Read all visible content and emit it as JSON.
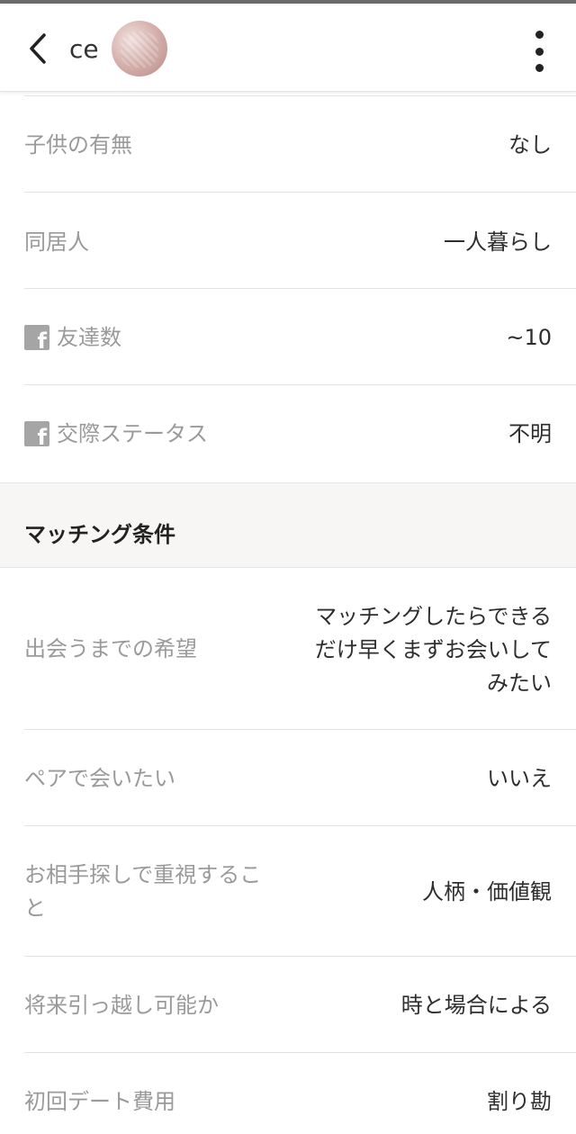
{
  "header": {
    "back_icon": "chevron-left-icon",
    "name": "ce",
    "more_icon": "more-vertical-icon"
  },
  "profile_rows": [
    {
      "label": "子供の有無",
      "value": "なし",
      "facebook": false
    },
    {
      "label": "同居人",
      "value": "一人暮らし",
      "facebook": false
    },
    {
      "label": "友達数",
      "value": "~10",
      "facebook": true
    },
    {
      "label": "交際ステータス",
      "value": "不明",
      "facebook": true
    }
  ],
  "facebook_icon_glyph": "f",
  "matching_section": {
    "title": "マッチング条件",
    "rows": [
      {
        "label": "出会うまでの希望",
        "value_lines": [
          "マッチングしたらできる",
          "だけ早くまずお会いして",
          "みたい"
        ]
      },
      {
        "label": "ペアで会いたい",
        "value": "いいえ"
      },
      {
        "label_lines": [
          "お相手探しで重視するこ",
          "と"
        ],
        "value": "人柄・価値観"
      },
      {
        "label": "将来引っ越し可能か",
        "value": "時と場合による"
      },
      {
        "label": "初回デート費用",
        "value": "割り勘"
      }
    ]
  }
}
